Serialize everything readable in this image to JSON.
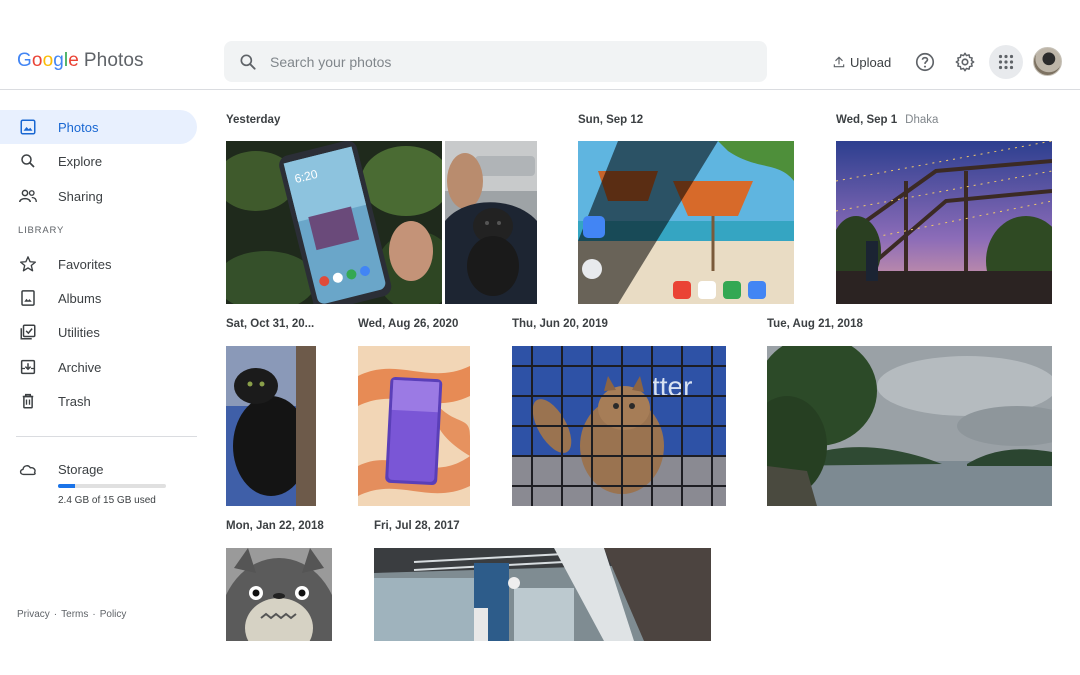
{
  "app": {
    "logo_google": "Google",
    "logo_product": "Photos"
  },
  "search": {
    "placeholder": "Search your photos"
  },
  "header": {
    "upload_label": "Upload",
    "icons": [
      "upload-icon",
      "help-icon",
      "settings-icon",
      "apps-icon",
      "avatar"
    ]
  },
  "sidebar": {
    "items": [
      {
        "label": "Photos",
        "icon": "photo-icon",
        "active": true
      },
      {
        "label": "Explore",
        "icon": "search-icon"
      },
      {
        "label": "Sharing",
        "icon": "people-icon"
      }
    ],
    "library_label": "LIBRARY",
    "library_items": [
      {
        "label": "Favorites",
        "icon": "star-icon"
      },
      {
        "label": "Albums",
        "icon": "album-icon"
      },
      {
        "label": "Utilities",
        "icon": "utilities-icon"
      },
      {
        "label": "Archive",
        "icon": "archive-icon"
      },
      {
        "label": "Trash",
        "icon": "trash-icon"
      }
    ],
    "storage": {
      "label": "Storage",
      "usage_text": "2.4 GB of 15 GB used",
      "used_fraction": 0.16
    },
    "footer": {
      "privacy": "Privacy",
      "sep": "·",
      "terms": "Terms",
      "policy": "Policy"
    }
  },
  "groups": [
    {
      "date": "Yesterday"
    },
    {
      "date": "Sun, Sep 12"
    },
    {
      "date": "Wed, Sep 1",
      "location": "Dhaka"
    },
    {
      "date": "Sat, Oct 31, 20..."
    },
    {
      "date": "Wed, Aug 26, 2020"
    },
    {
      "date": "Thu, Jun 20, 2019"
    },
    {
      "date": "Tue, Aug 21, 2018"
    },
    {
      "date": "Mon, Jan 22, 2018"
    },
    {
      "date": "Fri, Jul 28, 2017"
    }
  ],
  "colors": {
    "accent": "#1a73e8",
    "active_bg": "#e8f0fe",
    "search_bg": "#f1f3f4"
  }
}
